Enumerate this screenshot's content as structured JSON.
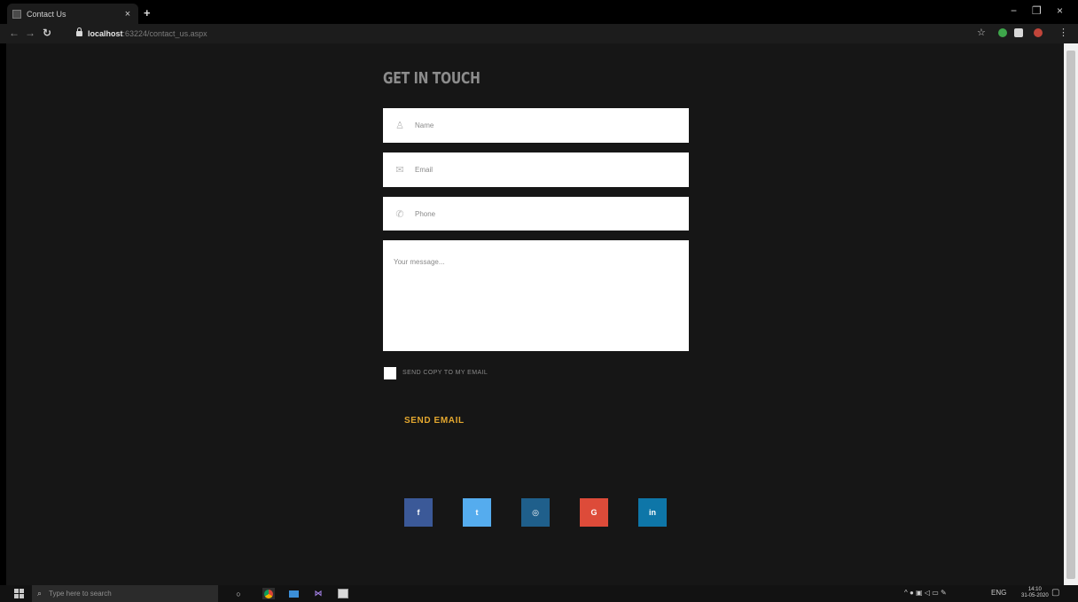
{
  "browser": {
    "tab_title": "Contact Us",
    "tab_close": "×",
    "new_tab": "+",
    "url_host": "localhost",
    "url_path": ":63224/contact_us.aspx",
    "window_min": "−",
    "window_max": "❐",
    "window_close": "×"
  },
  "page": {
    "title": "GET IN TOUCH",
    "fields": {
      "name_placeholder": "Name",
      "email_placeholder": "Email",
      "phone_placeholder": "Phone",
      "message_placeholder": "Your message..."
    },
    "checkbox_label": "SEND COPY TO MY EMAIL",
    "send_button": "SEND EMAIL",
    "social": [
      {
        "name": "facebook",
        "label": "f",
        "color": "#3b5998"
      },
      {
        "name": "twitter",
        "label": "t",
        "color": "#55acee"
      },
      {
        "name": "instagram",
        "label": "◎",
        "color": "#1f5f8b"
      },
      {
        "name": "google",
        "label": "G",
        "color": "#dd4b39"
      },
      {
        "name": "linkedin",
        "label": "in",
        "color": "#0e76a8"
      }
    ]
  },
  "taskbar": {
    "search_placeholder": "Type here to search",
    "tray_text": "ENG",
    "clock_time": "14:10",
    "clock_date": "31-05-2020"
  },
  "colors": {
    "page_background": "#161616",
    "accent": "#e3a72f"
  }
}
